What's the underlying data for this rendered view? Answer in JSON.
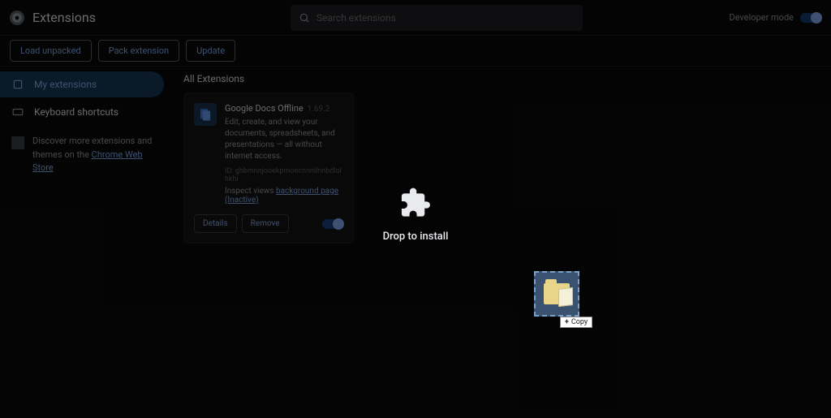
{
  "header": {
    "title": "Extensions",
    "search_placeholder": "Search extensions",
    "dev_mode_label": "Developer mode"
  },
  "toolbar": {
    "load_unpacked": "Load unpacked",
    "pack_extension": "Pack extension",
    "update": "Update"
  },
  "sidebar": {
    "my_extensions": "My extensions",
    "keyboard_shortcuts": "Keyboard shortcuts",
    "discover_text": "Discover more extensions and themes on the ",
    "cws_link": "Chrome Web Store"
  },
  "main": {
    "section_title": "All Extensions",
    "drop_label": "Drop to install"
  },
  "card": {
    "name": "Google Docs Offline",
    "version": "1.69.2",
    "description": "Edit, create, and view your documents, spreadsheets, and presentations — all without internet access.",
    "id_label": "ID: ghbmnnjooekpmoecnnnilnnbdlolhkhi",
    "inspect_label": "Inspect views ",
    "inspect_link": "background page (Inactive)",
    "details": "Details",
    "remove": "Remove"
  },
  "drag": {
    "copy_label": "Copy"
  },
  "colors": {
    "accent": "#8ab4f8",
    "bg": "#0a0a0a"
  }
}
